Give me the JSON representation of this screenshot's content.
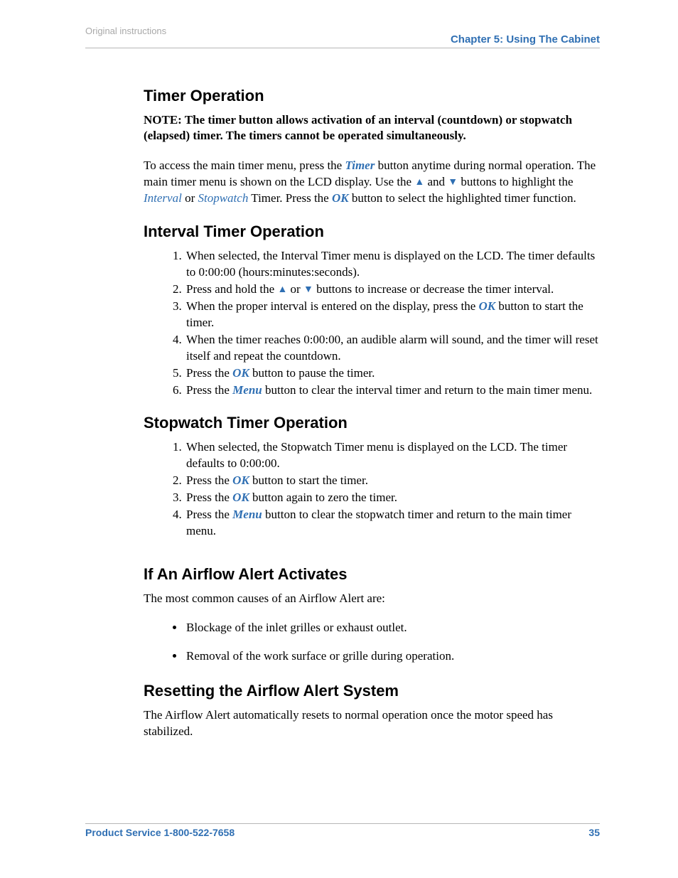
{
  "header": {
    "top_label": "Original instructions",
    "chapter": "Chapter 5: Using The Cabinet"
  },
  "glyphs": {
    "up": "▲",
    "down": "▼"
  },
  "refs": {
    "timer": "Timer",
    "interval": "Interval",
    "stopwatch": "Stopwatch",
    "ok": "OK",
    "menu": "Menu"
  },
  "sections": {
    "timer_op": {
      "title": "Timer Operation",
      "note": "NOTE:  The timer button allows activation of an interval (countdown) or stopwatch (elapsed) timer.  The timers cannot be operated simultaneously.",
      "para": {
        "p1a": "To access the main timer menu, press the ",
        "p1b": " button anytime during normal operation. The main timer menu is shown on the LCD display. Use the ",
        "p1c": " and ",
        "p1d": " buttons to highlight the ",
        "p1e": " or ",
        "p1f": " Timer. Press the ",
        "p1g": " button to select the highlighted timer function."
      }
    },
    "interval_op": {
      "title": "Interval Timer Operation",
      "items": {
        "i1": "When selected, the Interval Timer menu is displayed on the LCD. The timer defaults to 0:00:00 (hours:minutes:seconds).",
        "i2a": "Press and hold the ",
        "i2b": " or ",
        "i2c": " buttons to increase or decrease the timer interval.",
        "i3a": "When the proper interval is entered on the display, press the ",
        "i3b": " button to start the timer.",
        "i4": "When the timer reaches 0:00:00, an audible alarm will sound, and the timer will reset itself and repeat the countdown.",
        "i5a": "Press the ",
        "i5b": " button to pause the timer.",
        "i6a": "Press the ",
        "i6b": " button to clear the interval timer and return to the main timer menu."
      }
    },
    "stopwatch_op": {
      "title": "Stopwatch Timer Operation",
      "items": {
        "s1": "When selected, the Stopwatch Timer menu is displayed on the LCD. The timer defaults to 0:00:00.",
        "s2a": "Press the ",
        "s2b": " button to start the timer.",
        "s3a": "Press the ",
        "s3b": " button again to zero the timer.",
        "s4a": "Press the ",
        "s4b": " button to clear the stopwatch timer and return to the main timer menu."
      }
    },
    "airflow_alert": {
      "title": "If An Airflow Alert Activates",
      "intro": "The most common causes of an Airflow Alert are:",
      "bullets": {
        "b1": "Blockage of the inlet grilles or exhaust outlet.",
        "b2": "Removal of the work surface or grille during operation."
      }
    },
    "reset_airflow": {
      "title": "Resetting the Airflow Alert System",
      "para": "The Airflow Alert automatically resets to normal operation once the motor speed has stabilized."
    }
  },
  "footer": {
    "service": "Product Service 1-800-522-7658",
    "page": "35"
  }
}
